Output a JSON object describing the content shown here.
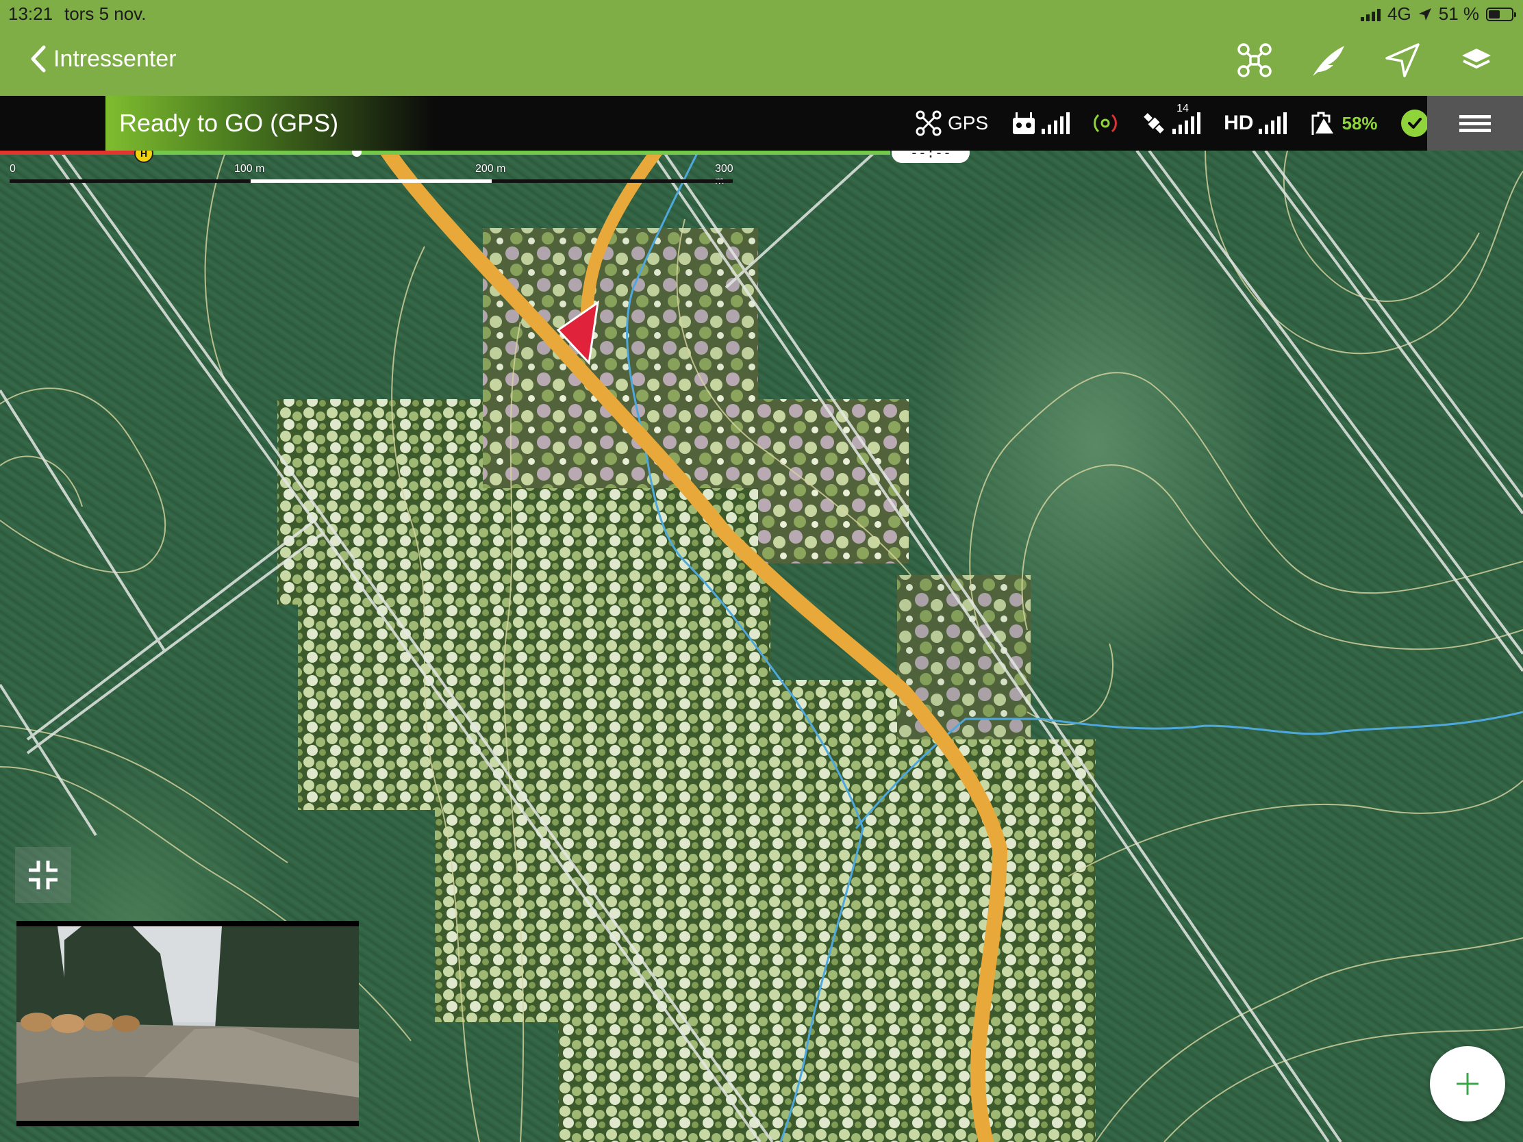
{
  "status_bar": {
    "time": "13:21",
    "date": "tors 5 nov.",
    "network": "4G",
    "battery": "51 %",
    "battery_level": 0.51
  },
  "nav": {
    "back_label": "Intressenter",
    "icons": [
      "drone-icon",
      "flight-icon",
      "location-arrow-icon",
      "layers-icon"
    ]
  },
  "telemetry": {
    "status": "Ready to GO (GPS)",
    "mode": "GPS",
    "satellites": "14",
    "video_label": "HD",
    "battery_percent": "58%"
  },
  "timeline": {
    "time": "--:--",
    "home_marker": "H",
    "progress": 0.16
  },
  "scale_bar": {
    "labels": [
      "0",
      "100 m",
      "200 m",
      "300 m"
    ]
  },
  "colors": {
    "header_green": "#7fae47",
    "route": "#e9a93a",
    "water": "#4fa8dc",
    "aircraft": "#e0233a",
    "status_ok": "#8fd43a"
  },
  "add_button": "+"
}
